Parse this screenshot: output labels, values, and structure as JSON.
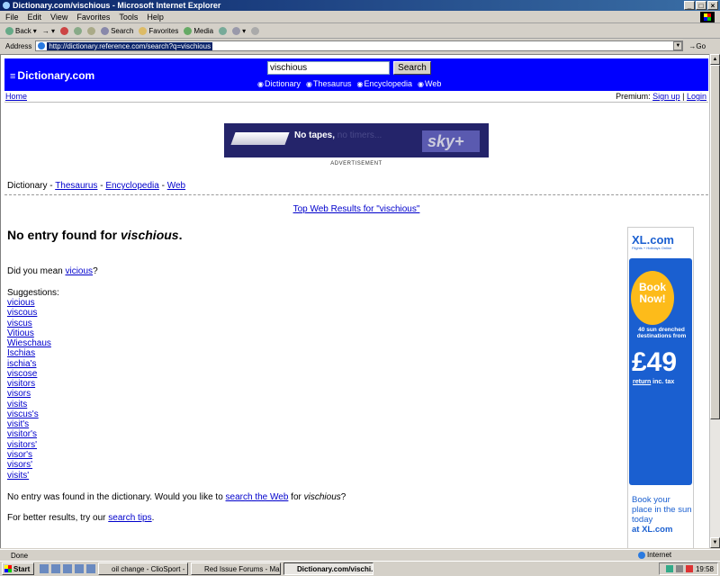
{
  "window": {
    "title": "Dictionary.com/vischious - Microsoft Internet Explorer"
  },
  "menu": [
    "File",
    "Edit",
    "View",
    "Favorites",
    "Tools",
    "Help"
  ],
  "toolbar": {
    "back": "Back",
    "search": "Search",
    "favorites": "Favorites",
    "media": "Media"
  },
  "address": {
    "label": "Address",
    "url": "http://dictionary.reference.com/search?q=vischious",
    "go": "Go"
  },
  "site": {
    "logo": "Dictionary.com",
    "search_value": "vischious",
    "search_button": "Search",
    "radios": [
      "Dictionary",
      "Thesaurus",
      "Encyclopedia",
      "Web"
    ],
    "home": "Home",
    "premium_label": "Premium:",
    "signup": "Sign up",
    "login": "Login"
  },
  "ad_banner": {
    "text_main": "No tapes,",
    "text_faded": "no timers...",
    "brand": "sky+",
    "label": "ADVERTISEMENT"
  },
  "nav": {
    "dictionary": "Dictionary",
    "thesaurus": "Thesaurus",
    "encyclopedia": "Encyclopedia",
    "web": "Web"
  },
  "top_web_results": "Top Web Results for \"vischious\"",
  "result": {
    "noentry_prefix": "No entry found for ",
    "term": "vischious",
    "didyou_prefix": "Did you mean ",
    "didyou_word": "vicious",
    "suggestions_heading": "Suggestions:",
    "suggestions": [
      "vicious",
      "viscous",
      "viscus",
      "Vitious",
      "Wieschaus",
      "Ischias",
      "ischia's",
      "viscose",
      "visitors",
      "visors",
      "visits",
      "viscus's",
      "visit's",
      "visitor's",
      "visitors'",
      "visor's",
      "visors'",
      "visits'"
    ],
    "noentry2_prefix": "No entry was found in the dictionary. Would you like to ",
    "search_web": "search the Web",
    "noentry2_mid": " for ",
    "noentry2_suffix": "?",
    "better_prefix": "For better results, try our ",
    "search_tips": "search tips",
    "better_suffix": "."
  },
  "xl_ad": {
    "logo": "XL.com",
    "tagline": "Flights + Holidays Online",
    "book_now": "Book Now!",
    "destinations": "40 sun drenched destinations from",
    "price": "£49",
    "return_word": "return",
    "return_rest": " inc. tax",
    "cta": "Book your place in the sun today",
    "cta_site": "at XL.com"
  },
  "status": {
    "text": "Done",
    "zone": "Internet"
  },
  "taskbar": {
    "start": "Start",
    "tasks": [
      "oil change - ClioSport - Mic...",
      "Red Issue Forums - Main F...",
      "Dictionary.com/vischi..."
    ],
    "clock": "19:58"
  }
}
